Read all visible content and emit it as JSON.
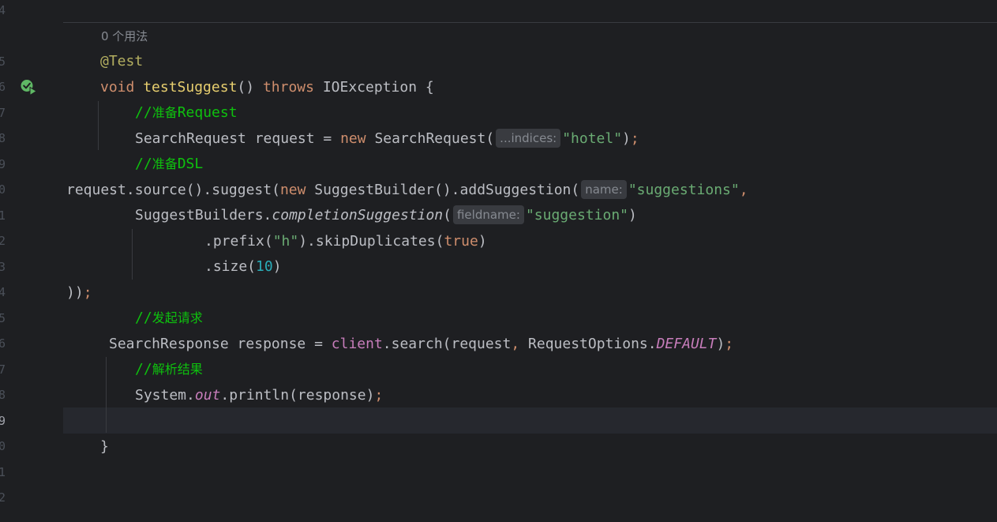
{
  "gutter": {
    "line_numbers": [
      "4",
      "5",
      "6",
      "7",
      "8",
      "9",
      "0",
      "1",
      "2",
      "3",
      "4",
      "5",
      "6",
      "7",
      "8",
      "9",
      "0",
      "1",
      "2"
    ]
  },
  "usage_hint": "0 个用法",
  "code": {
    "annotation": "@Test",
    "void": "void",
    "method_name": "testSuggest",
    "parens": "()",
    "throws": "throws",
    "exception": "IOException {",
    "comment_1_slash": "//",
    "comment_1_cn": "准备",
    "comment_1_en": "Request",
    "search_request_decl": "SearchRequest request = ",
    "new_1": "new",
    "search_request_ctor": " SearchRequest(",
    "hint_indices": "...indices:",
    "str_hotel": "\"hotel\"",
    "close_1": ")",
    "semi_1": ";",
    "comment_2_slash": "//",
    "comment_2_cn": "准备",
    "comment_2_en": "DSL",
    "req_source": "request.source().suggest(",
    "new_2": "new",
    "suggest_builder": " SuggestBuilder().addSuggestion(",
    "hint_name": "name:",
    "str_suggestions": "\"suggestions\"",
    "comma_1": ",",
    "suggest_builders": "SuggestBuilders.",
    "completion_suggestion": "completionSuggestion",
    "open_paren": "(",
    "hint_fieldname": "fieldname:",
    "str_suggestion": "\"suggestion\"",
    "close_2": ")",
    "prefix_call": ".prefix(",
    "str_h": "\"h\"",
    "skip_dup": ").skipDuplicates(",
    "true_kw": "true",
    "close_3": ")",
    "size_call": ".size(",
    "num_10": "10",
    "close_4": ")",
    "close_all": "))",
    "semi_2": ";",
    "comment_3_slash": "//",
    "comment_3_cn": "发起请求",
    "search_response_decl": "SearchResponse response = ",
    "client_field": "client",
    "search_call": ".search(request",
    "comma_2": ",",
    "request_options": " RequestOptions.",
    "default_field": "DEFAULT",
    "close_5": ")",
    "semi_3": ";",
    "comment_4_slash": "//",
    "comment_4_cn": "解析结果",
    "system": "System.",
    "out_field": "out",
    "println": ".println(response)",
    "semi_4": ";",
    "closing_brace": "}"
  },
  "colors": {
    "background": "#1e1f22",
    "keyword": "#cf8e6d",
    "string": "#6aab73",
    "comment": "#0ec10e",
    "annotation": "#b3ae60",
    "method": "#e8cf6f",
    "static_field": "#c77dbb"
  },
  "icons": {
    "run_gutter": "run-test-passed-icon"
  }
}
